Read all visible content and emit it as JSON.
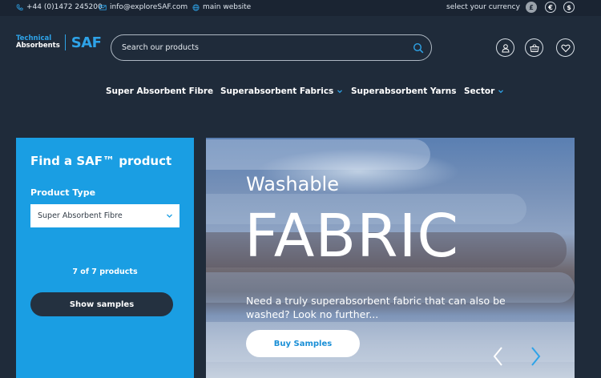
{
  "topbar": {
    "phone": "+44 (0)1472 245200",
    "email": "info@exploreSAF.com",
    "website": "main website",
    "currency_label": "select your currency",
    "currencies": [
      "£",
      "€",
      "$"
    ]
  },
  "logo": {
    "line1": "Technical",
    "line2": "Absorbents",
    "brand": "SAF"
  },
  "search": {
    "placeholder": "Search our products"
  },
  "nav": {
    "items": [
      {
        "label": "Super Absorbent Fibre"
      },
      {
        "label": "Superabsorbent Fabrics"
      },
      {
        "label": "Superabsorbent Yarns"
      },
      {
        "label": "Sector"
      }
    ]
  },
  "finder": {
    "title": "Find a SAF™ product",
    "product_type_label": "Product Type",
    "selected_type": "Super Absorbent Fibre",
    "count": "7 of 7 products",
    "button": "Show samples"
  },
  "hero": {
    "subtitle": "Washable",
    "title": "FABRIC",
    "description": "Need a truly superabsorbent fabric that can also be washed? Look no further...",
    "button": "Buy Samples"
  },
  "colors": {
    "accent": "#1a9ee3",
    "background": "#1f2b3a",
    "topbar": "#1a2432"
  },
  "icons": [
    "phone-icon",
    "mail-icon",
    "globe-icon",
    "search-icon",
    "account-icon",
    "basket-icon",
    "heart-icon",
    "chevron-down-icon",
    "chevron-left-icon",
    "chevron-right-icon"
  ]
}
